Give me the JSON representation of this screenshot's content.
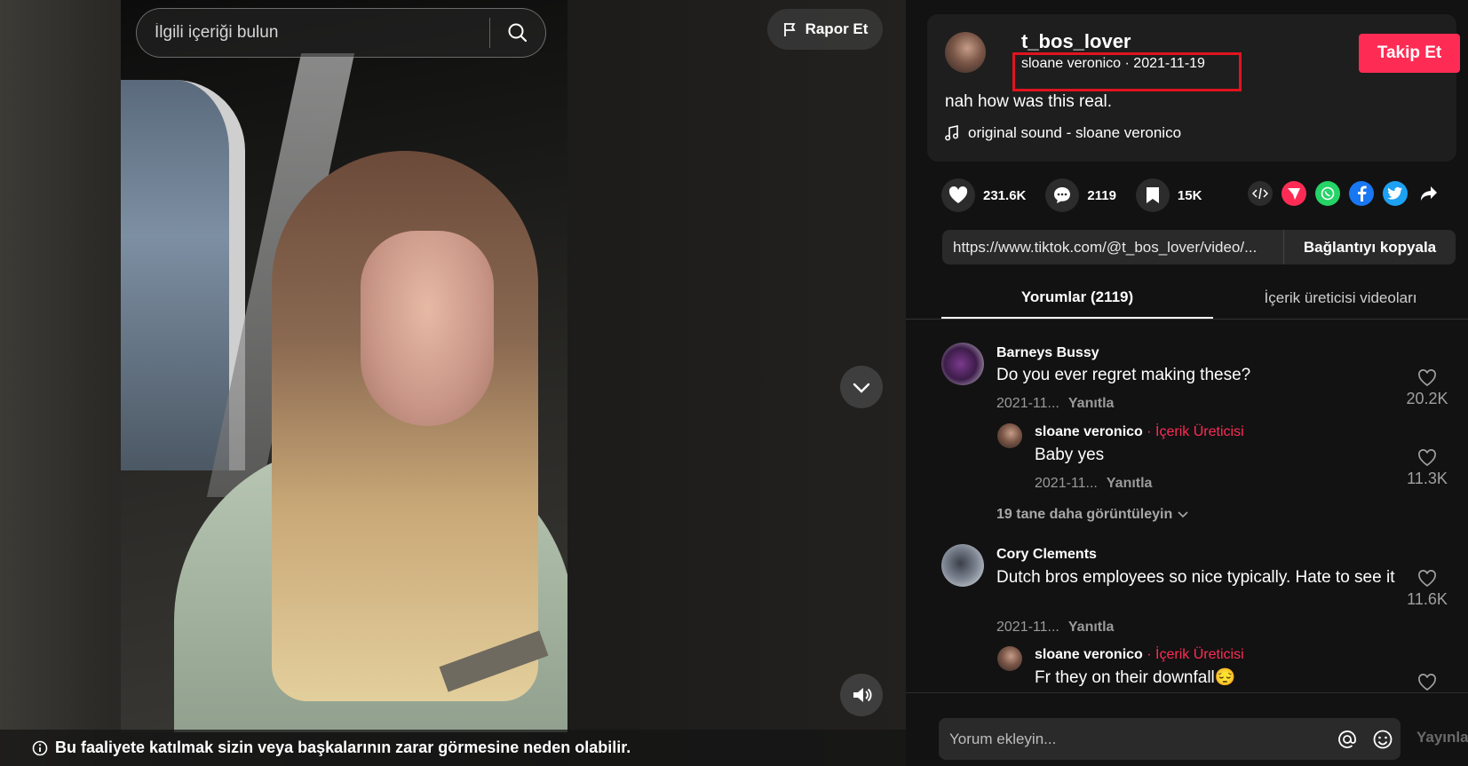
{
  "search": {
    "placeholder": "İlgili içeriği bulun"
  },
  "report": {
    "label": "Rapor Et"
  },
  "warning": {
    "text": "Bu faaliyete katılmak sizin veya başkalarının zarar görmesine neden olabilir."
  },
  "author": {
    "username": "t_bos_lover",
    "display_name": "sloane veronico",
    "date": "2021-11-19",
    "sub_line": "sloane veronico · 2021-11-19",
    "follow_label": "Takip Et",
    "caption": "nah how was this real.",
    "sound": "original sound - sloane veronico"
  },
  "stats": {
    "likes": "231.6K",
    "comments": "2119",
    "saves": "15K"
  },
  "link": {
    "url": "https://www.tiktok.com/@t_bos_lover/video/...",
    "copy_label": "Bağlantıyı kopyala"
  },
  "tabs": [
    {
      "label": "Yorumlar (2119)",
      "active": true
    },
    {
      "label": "İçerik üreticisi videoları",
      "active": false
    }
  ],
  "comments": [
    {
      "name": "Barneys Bussy",
      "text": "Do you ever regret making these?",
      "date": "2021-11...",
      "reply_label": "Yanıtla",
      "likes": "20.2K",
      "reply": {
        "name": "sloane veronico",
        "creator_badge": "· İçerik Üreticisi",
        "text": "Baby yes",
        "date": "2021-11...",
        "reply_label": "Yanıtla",
        "likes": "11.3K"
      },
      "more": "19 tane daha görüntüleyin"
    },
    {
      "name": "Cory Clements",
      "text": "Dutch bros employees so nice typically. Hate to see it",
      "date": "2021-11...",
      "reply_label": "Yanıtla",
      "likes": "11.6K",
      "reply": {
        "name": "sloane veronico",
        "creator_badge": "· İçerik Üreticisi",
        "text": "Fr they on their downfall😔"
      }
    }
  ],
  "composer": {
    "placeholder": "Yorum ekleyin...",
    "post_label": "Yayınla"
  },
  "colors": {
    "accent": "#fe2c55",
    "highlight": "#e0141e",
    "panel_bg": "#121212"
  },
  "icons": [
    "search-icon",
    "flag-icon",
    "chevron-down-icon",
    "volume-icon",
    "info-icon",
    "music-note-icon",
    "heart-icon",
    "comment-icon",
    "bookmark-icon",
    "embed-icon",
    "send-icon",
    "whatsapp-icon",
    "facebook-icon",
    "twitter-icon",
    "share-arrow-icon",
    "at-icon",
    "emoji-icon"
  ]
}
